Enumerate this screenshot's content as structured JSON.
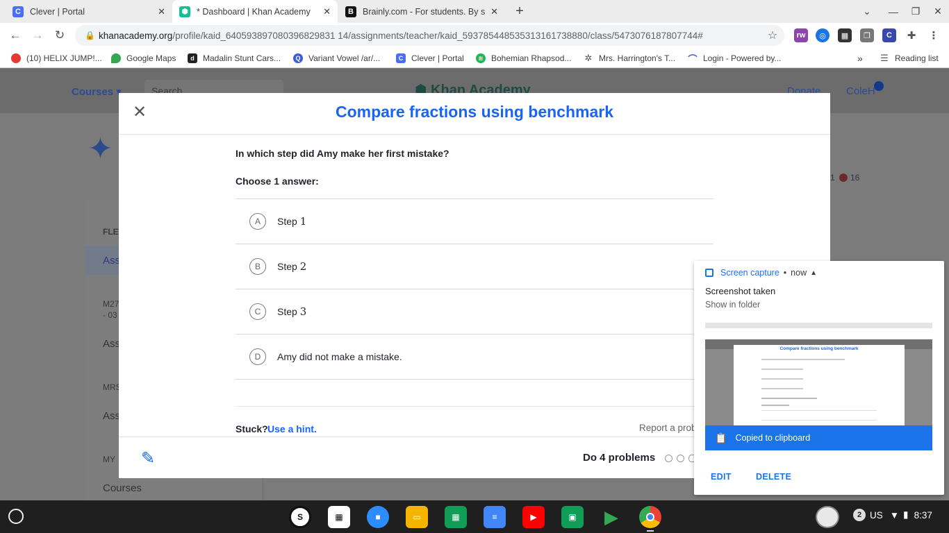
{
  "tabs": [
    {
      "title": "Clever | Portal",
      "favicon": "C",
      "color": "#4c6ef5",
      "active": false
    },
    {
      "title": "* Dashboard | Khan Academy",
      "favicon": "K",
      "color": "#14bf96",
      "active": true
    },
    {
      "title": "Brainly.com - For students. By st",
      "favicon": "B",
      "color": "#111111",
      "active": false
    }
  ],
  "new_tab": "+",
  "toolbar": {
    "url_host": "khanacademy.org",
    "url_path": "/profile/kaid_640593897080396829831 14/assignments/teacher/kaid_593785448535313161738880/class/5473076187807744#"
  },
  "bookmarks": [
    {
      "label": "(10) HELIX JUMP!...",
      "icon": "helix-icon",
      "color": "#e53935"
    },
    {
      "label": "Google Maps",
      "icon": "map-pin-icon",
      "color": "#34a853"
    },
    {
      "label": "Madalin Stunt Cars...",
      "icon": "madalin-icon",
      "color": "#222222"
    },
    {
      "label": "Variant Vowel /ar/...",
      "icon": "variant-icon",
      "color": "#3b5bdb"
    },
    {
      "label": "Clever | Portal",
      "icon": "clever-icon",
      "color": "#4c6ef5"
    },
    {
      "label": "Bohemian Rhapsod...",
      "icon": "spotify-icon",
      "color": "#1db954"
    },
    {
      "label": "Mrs. Harrington's T...",
      "icon": "gear-icon",
      "color": "#555555"
    },
    {
      "label": "Login - Powered by...",
      "icon": "login-icon",
      "color": "#3b5bdb"
    }
  ],
  "bookmarks_overflow": "»",
  "reading_list": "Reading list",
  "background": {
    "courses": "Courses",
    "search": "Search",
    "brand": "Khan Academy",
    "donate": "Donate",
    "user": "ColeH",
    "stat_a": "1",
    "stat_b": "16",
    "left_items": [
      "FLEX",
      "Assi",
      "M27",
      "- 03",
      "Assi",
      "MRS",
      "Assi",
      "MY",
      "Courses"
    ]
  },
  "modal": {
    "title": "Compare fractions using benchmark",
    "question": "In which step did Amy make her first mistake?",
    "choose": "Choose 1 answer:",
    "choices": [
      {
        "letter": "A",
        "text": "Step ",
        "num": "1"
      },
      {
        "letter": "B",
        "text": "Step ",
        "num": "2"
      },
      {
        "letter": "C",
        "text": "Step ",
        "num": "3"
      },
      {
        "letter": "D",
        "text": "Amy did not make a mistake.",
        "num": ""
      }
    ],
    "stuck": "Stuck?",
    "hint": "Use a hint.",
    "report": "Report a prob",
    "do_problems": "Do 4 problems"
  },
  "notification": {
    "source": "Screen capture",
    "time": "now",
    "title": "Screenshot taken",
    "show_folder": "Show in folder",
    "copied": "Copied to clipboard",
    "edit": "EDIT",
    "delete": "DELETE",
    "thumb_title": "Compare fractions using benchmark"
  },
  "status": {
    "notif_count": "2",
    "locale": "US",
    "time": "8:37"
  }
}
